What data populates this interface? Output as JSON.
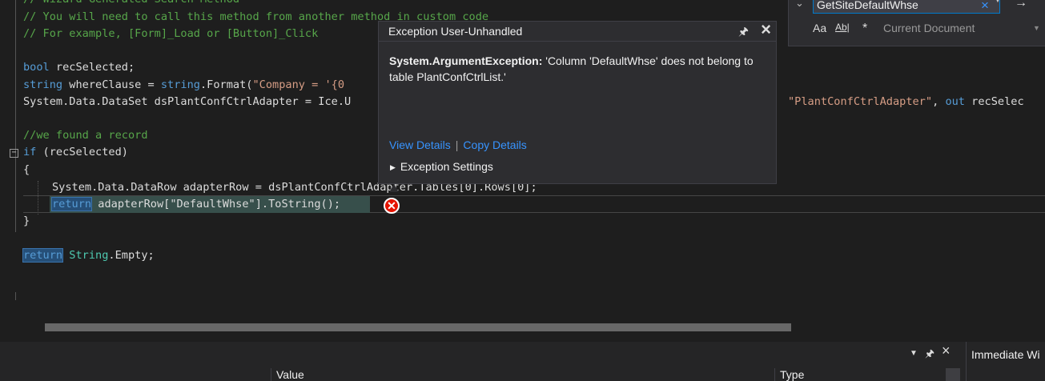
{
  "code": {
    "line1": "// Wizard Generated Search Method",
    "line2": "// You will need to call this method from another method in custom code",
    "line3": "// For example, [Form]_Load or [Button]_Click",
    "line5_kw": "bool",
    "line5_rest": " recSelected;",
    "line6_kw": "string",
    "line6_mid": " whereClause = ",
    "line6_kw2": "string",
    "line6_rest": ".Format(",
    "line6_str": "\"Company = '{0",
    "line7_a": "System.Data.DataSet dsPlantConfCtrlAdapter = Ice.U",
    "line7_str": "\"PlantConfCtrlAdapter\"",
    "line7_b": ", ",
    "line7_kw": "out",
    "line7_c": " recSelec",
    "line9": "//we found a record",
    "line10_kw": "if",
    "line10_rest": " (recSelected)",
    "line11": "{",
    "line12": "System.Data.DataRow adapterRow = dsPlantConfCtrlAdapter.Tables[0].Rows[0];",
    "line13_kw": "return",
    "line13_rest": " adapterRow[\"DefaultWhse\"].ToString();",
    "line14": "}",
    "line16_kw": "return",
    "line16_ty": " String",
    "line16_rest": ".Empty;"
  },
  "exception_popup": {
    "title": "Exception User-Unhandled",
    "exception_type": "System.ArgumentException:",
    "message": " 'Column 'DefaultWhse' does not belong to table PlantConfCtrlList.'",
    "view_details": "View Details",
    "separator": "|",
    "copy_details": "Copy Details",
    "exception_settings": "Exception Settings"
  },
  "find_bar": {
    "search_value": "GetSiteDefaultWhse",
    "match_case": "Aa",
    "match_word": "Ab|",
    "regex": "*",
    "scope": "Current Document"
  },
  "bottom_panel": {
    "value_header": "Value",
    "type_header": "Type",
    "immediate_tab": "Immediate Wi"
  },
  "colors": {
    "error": "#e51400",
    "link": "#3794ff",
    "accent": "#007acc"
  }
}
